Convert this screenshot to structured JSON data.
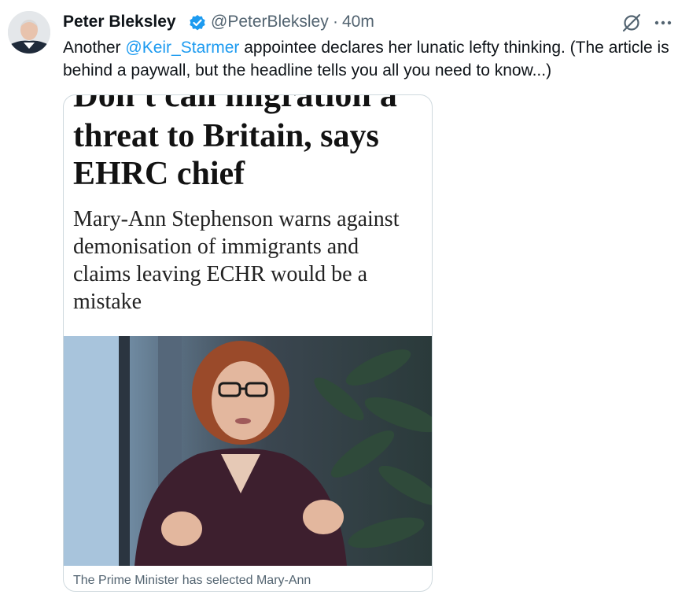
{
  "tweet": {
    "display_name": "Peter Bleksley",
    "handle": "@PeterBleksley",
    "separator": "·",
    "time": "40m",
    "text_prefix": "Another ",
    "mention": "@Keir_Starmer",
    "text_suffix": " appointee declares her lunatic lefty thinking. (The article is behind a paywall, but the headline tells you all you need to know...)",
    "icons": {
      "avatar": "avatar-photo",
      "verified": "verified-badge-icon",
      "grok": "grok-icon",
      "more": "more-options-icon"
    }
  },
  "card": {
    "headline_cut": "Don't call migration a",
    "headline": "threat to Britain, says EHRC chief",
    "standfirst": "Mary-Ann Stephenson warns against demonisation of immigrants and claims leaving ECHR would be a mistake",
    "caption": "The Prime Minister has selected Mary-Ann"
  },
  "colors": {
    "link": "#1d9bf0",
    "verified": "#1d9bf0",
    "secondary_text": "#536471",
    "border": "#cfd9de"
  }
}
